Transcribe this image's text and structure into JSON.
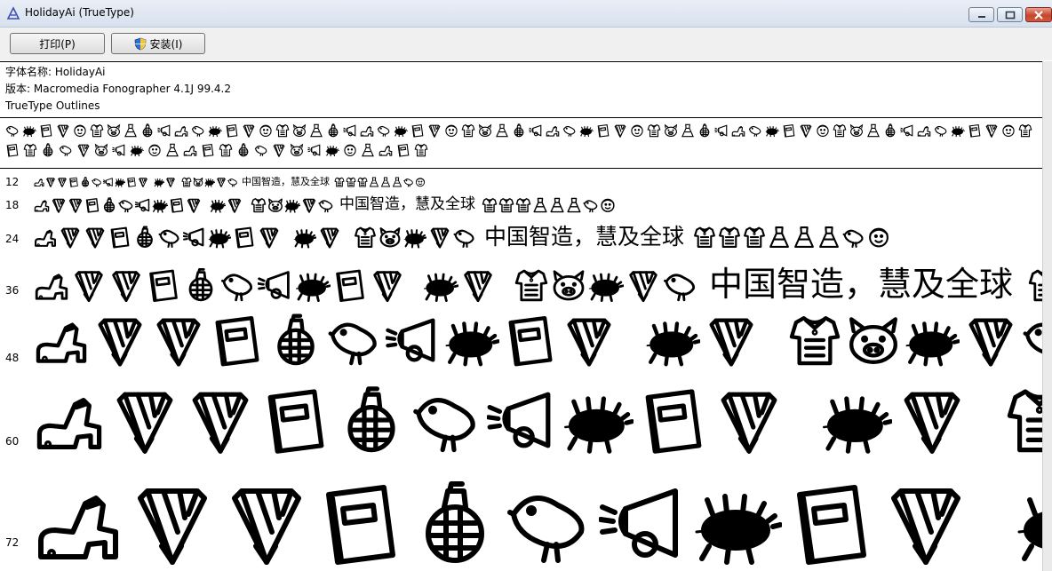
{
  "window": {
    "title": "HolidayAi (TrueType)"
  },
  "toolbar": {
    "print_label": "打印(P)",
    "install_label": "安装(I)"
  },
  "info": {
    "font_name": "字体名称: HolidayAi",
    "version": "版本: Macromedia Fonographer 4.1J 99.4.2",
    "type": "TrueType Outlines"
  },
  "samples": {
    "text": "中国智造，慧及全球",
    "sizes": [
      "12",
      "18",
      "24",
      "36",
      "48",
      "60",
      "72"
    ]
  },
  "icons": {
    "app": "font-file-icon",
    "shield": "uac-shield-icon",
    "glyph_set": [
      "shoe-icon",
      "pencil-icon",
      "book-icon",
      "grenade-icon",
      "bird-icon",
      "megaphone-icon",
      "beetle-icon",
      "shirt-icon",
      "pig-icon",
      "dress-icon",
      "face-icon"
    ]
  }
}
